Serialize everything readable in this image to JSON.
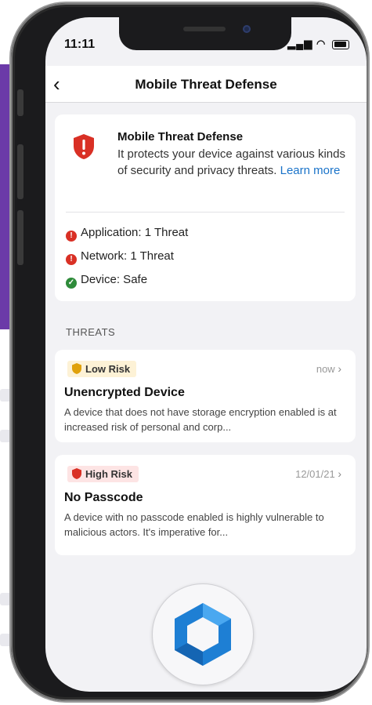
{
  "status_bar": {
    "time": "11:11",
    "signal": "▂▄▆",
    "wifi": "◠"
  },
  "nav": {
    "back": "‹",
    "title": "Mobile Threat Defense"
  },
  "summary": {
    "title": "Mobile Threat Defense",
    "description": "It protects your device against various kinds of security and privacy threats.",
    "learn_more": "Learn more",
    "rows": [
      {
        "label": "Application: 1 Threat",
        "status": "threat"
      },
      {
        "label": "Network: 1 Threat",
        "status": "threat"
      },
      {
        "label": "Device: Safe",
        "status": "safe"
      }
    ]
  },
  "threats": {
    "header": "THREATS",
    "items": [
      {
        "risk": "Low Risk",
        "time": "now",
        "title": "Unencrypted Device",
        "description": "A device that does not have storage encryption enabled is at increased risk of personal and corp..."
      },
      {
        "risk": "High Risk",
        "time": "12/01/21",
        "title": "No Passcode",
        "description": "A device with no passcode enabled is highly vulnerable to malicious actors. It's imperative for..."
      }
    ]
  },
  "colors": {
    "threat_red": "#d93025",
    "safe_green": "#2e8b3a",
    "low_risk_gold": "#e0a10a",
    "link_blue": "#1a73c9",
    "logo_blue": "#1e7fd4"
  },
  "icons": {
    "summary": "shield-alert-icon",
    "back": "chevron-left-icon",
    "threat_dot": "alert-circle-icon",
    "safe_dot": "check-circle-icon",
    "low_risk": "shield-icon",
    "high_risk": "shield-icon",
    "row_chevron": "chevron-right-icon",
    "app_logo": "hexagon-logo-icon"
  }
}
